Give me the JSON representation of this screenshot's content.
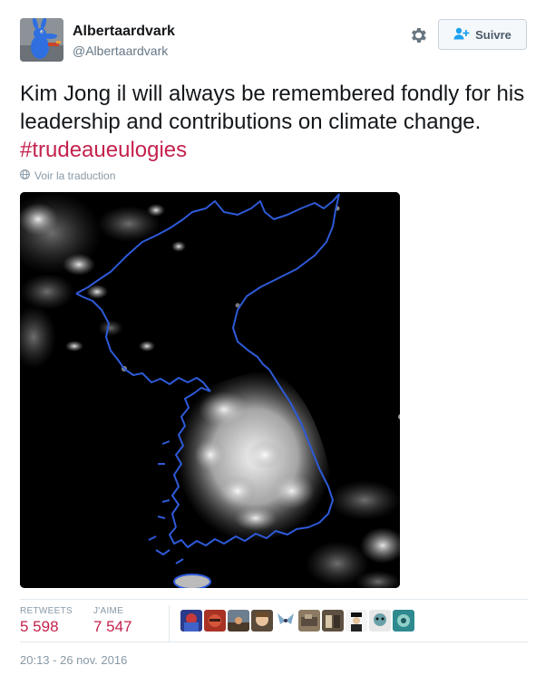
{
  "user": {
    "name": "Albertaardvark",
    "handle": "@Albertaardvark"
  },
  "header": {
    "settings_icon": "gear-icon",
    "follow_icon": "add-user-icon",
    "follow_label": "Suivre"
  },
  "tweet": {
    "text": "Kim Jong il will always be remembered fondly for his leadership and contributions on climate change.",
    "hashtag": "#trudeaueulogies",
    "translate_label": "Voir la traduction",
    "translate_icon": "globe-icon"
  },
  "stats": {
    "retweets_label": "RETWEETS",
    "retweets_value": "5 598",
    "likes_label": "J'AIME",
    "likes_value": "7 547"
  },
  "likers_count_shown": 10,
  "timestamp": "20:13 - 26 nov. 2016",
  "colors": {
    "hashtag": "#c4224d",
    "coastline": "#2e5ad8",
    "muted": "#8899a6"
  }
}
